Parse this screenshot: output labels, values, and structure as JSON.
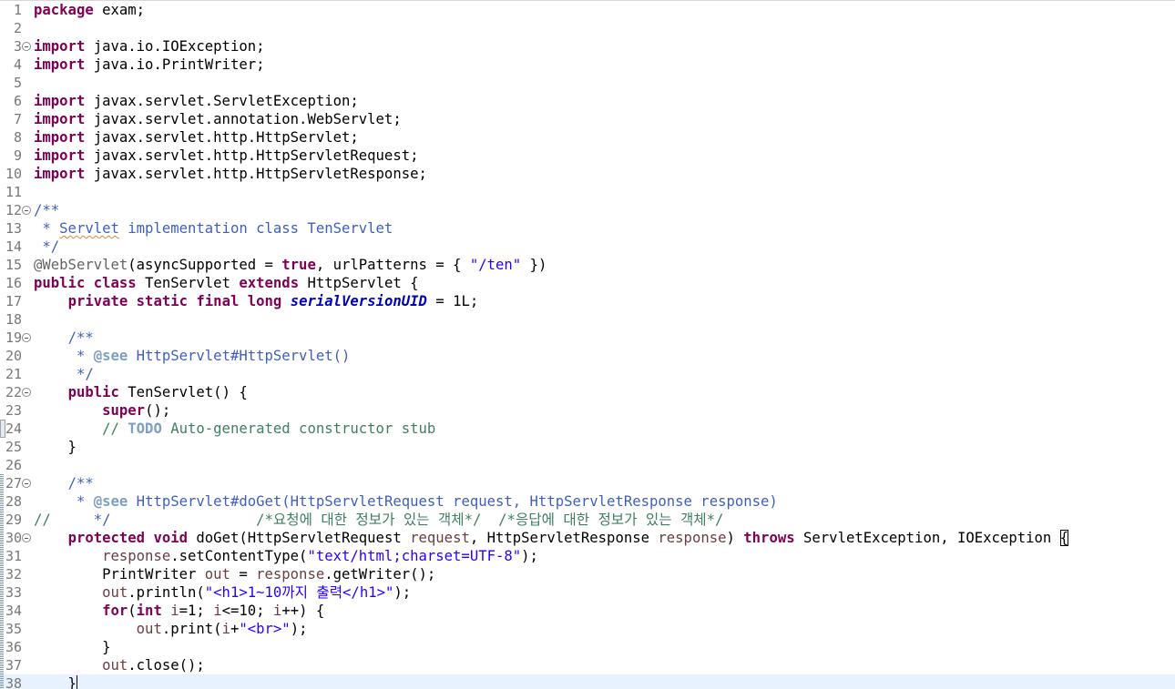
{
  "editor": {
    "language": "java",
    "file_package": "exam",
    "current_line": 38,
    "colors": {
      "keyword": "#7f0055",
      "string": "#2a00ff",
      "javadoc": "#3f5fbf",
      "javadoc_tag": "#7f9fbf",
      "comment": "#3f7f5f",
      "annotation": "#646464",
      "field": "#0000c0",
      "parameter": "#6a3e3e",
      "line_number": "#787878",
      "current_line_bg": "#e8f2fe"
    },
    "lines": [
      {
        "n": "1",
        "fold": false,
        "marker": "",
        "tokens": [
          [
            "kw",
            "package"
          ],
          [
            "plain",
            " exam;"
          ]
        ]
      },
      {
        "n": "2",
        "fold": false,
        "marker": "",
        "tokens": []
      },
      {
        "n": "3",
        "fold": true,
        "marker": "",
        "tokens": [
          [
            "kw",
            "import"
          ],
          [
            "plain",
            " java.io.IOException;"
          ]
        ]
      },
      {
        "n": "4",
        "fold": false,
        "marker": "",
        "tokens": [
          [
            "kw",
            "import"
          ],
          [
            "plain",
            " java.io.PrintWriter;"
          ]
        ]
      },
      {
        "n": "5",
        "fold": false,
        "marker": "",
        "tokens": []
      },
      {
        "n": "6",
        "fold": false,
        "marker": "",
        "tokens": [
          [
            "kw",
            "import"
          ],
          [
            "plain",
            " javax.servlet.ServletException;"
          ]
        ]
      },
      {
        "n": "7",
        "fold": false,
        "marker": "",
        "tokens": [
          [
            "kw",
            "import"
          ],
          [
            "plain",
            " javax.servlet.annotation.WebServlet;"
          ]
        ]
      },
      {
        "n": "8",
        "fold": false,
        "marker": "",
        "tokens": [
          [
            "kw",
            "import"
          ],
          [
            "plain",
            " javax.servlet.http.HttpServlet;"
          ]
        ]
      },
      {
        "n": "9",
        "fold": false,
        "marker": "",
        "tokens": [
          [
            "kw",
            "import"
          ],
          [
            "plain",
            " javax.servlet.http.HttpServletRequest;"
          ]
        ]
      },
      {
        "n": "10",
        "fold": false,
        "marker": "",
        "tokens": [
          [
            "kw",
            "import"
          ],
          [
            "plain",
            " javax.servlet.http.HttpServletResponse;"
          ]
        ]
      },
      {
        "n": "11",
        "fold": false,
        "marker": "",
        "tokens": []
      },
      {
        "n": "12",
        "fold": true,
        "marker": "",
        "tokens": [
          [
            "jdoc",
            "/**"
          ]
        ]
      },
      {
        "n": "13",
        "fold": false,
        "marker": "",
        "tokens": [
          [
            "jdoc",
            " * "
          ],
          [
            "spell",
            "Servlet"
          ],
          [
            "jdoc",
            " implementation class TenServlet"
          ]
        ]
      },
      {
        "n": "14",
        "fold": false,
        "marker": "",
        "tokens": [
          [
            "jdoc",
            " */"
          ]
        ]
      },
      {
        "n": "15",
        "fold": false,
        "marker": "",
        "tokens": [
          [
            "ann",
            "@WebServlet"
          ],
          [
            "plain",
            "(asyncSupported = "
          ],
          [
            "kw",
            "true"
          ],
          [
            "plain",
            ", urlPatterns = { "
          ],
          [
            "str",
            "\"/ten\""
          ],
          [
            "plain",
            " })"
          ]
        ]
      },
      {
        "n": "16",
        "fold": false,
        "marker": "",
        "tokens": [
          [
            "kw",
            "public"
          ],
          [
            "plain",
            " "
          ],
          [
            "kw",
            "class"
          ],
          [
            "plain",
            " TenServlet "
          ],
          [
            "kw",
            "extends"
          ],
          [
            "plain",
            " HttpServlet {"
          ]
        ]
      },
      {
        "n": "17",
        "fold": false,
        "marker": "",
        "tokens": [
          [
            "plain",
            "    "
          ],
          [
            "kw",
            "private"
          ],
          [
            "plain",
            " "
          ],
          [
            "kw",
            "static"
          ],
          [
            "plain",
            " "
          ],
          [
            "kw",
            "final"
          ],
          [
            "plain",
            " "
          ],
          [
            "kw",
            "long"
          ],
          [
            "plain",
            " "
          ],
          [
            "cfield",
            "serialVersionUID"
          ],
          [
            "plain",
            " = 1L;"
          ]
        ]
      },
      {
        "n": "18",
        "fold": false,
        "marker": "",
        "tokens": []
      },
      {
        "n": "19",
        "fold": true,
        "marker": "",
        "tokens": [
          [
            "plain",
            "    "
          ],
          [
            "jdoc",
            "/**"
          ]
        ]
      },
      {
        "n": "20",
        "fold": false,
        "marker": "",
        "tokens": [
          [
            "plain",
            "    "
          ],
          [
            "jdoc",
            " * "
          ],
          [
            "jtag",
            "@see"
          ],
          [
            "jdoc",
            " HttpServlet#HttpServlet()"
          ]
        ]
      },
      {
        "n": "21",
        "fold": false,
        "marker": "",
        "tokens": [
          [
            "plain",
            "    "
          ],
          [
            "jdoc",
            " */"
          ]
        ]
      },
      {
        "n": "22",
        "fold": true,
        "marker": "",
        "tokens": [
          [
            "plain",
            "    "
          ],
          [
            "kw",
            "public"
          ],
          [
            "plain",
            " TenServlet() {"
          ]
        ]
      },
      {
        "n": "23",
        "fold": false,
        "marker": "",
        "tokens": [
          [
            "plain",
            "        "
          ],
          [
            "kw",
            "super"
          ],
          [
            "plain",
            "();"
          ]
        ]
      },
      {
        "n": "24",
        "fold": false,
        "marker": "quick",
        "tokens": [
          [
            "plain",
            "        "
          ],
          [
            "comment",
            "// "
          ],
          [
            "todo",
            "TODO"
          ],
          [
            "comment",
            " Auto-generated constructor stub"
          ]
        ]
      },
      {
        "n": "25",
        "fold": false,
        "marker": "",
        "tokens": [
          [
            "plain",
            "    }"
          ]
        ]
      },
      {
        "n": "26",
        "fold": false,
        "marker": "",
        "tokens": []
      },
      {
        "n": "27",
        "fold": true,
        "marker": "change",
        "tokens": [
          [
            "plain",
            "    "
          ],
          [
            "jdoc",
            "/**"
          ]
        ]
      },
      {
        "n": "28",
        "fold": false,
        "marker": "change",
        "tokens": [
          [
            "plain",
            "    "
          ],
          [
            "jdoc",
            " * "
          ],
          [
            "jtag",
            "@see"
          ],
          [
            "jdoc",
            " HttpServlet#doGet(HttpServletRequest request, HttpServletResponse response)"
          ]
        ]
      },
      {
        "n": "29",
        "fold": false,
        "marker": "change",
        "tokens": [
          [
            "comment",
            "//"
          ],
          [
            "plain",
            "   "
          ],
          [
            "jdoc",
            "  */"
          ],
          [
            "plain",
            "                 "
          ],
          [
            "comment",
            "/*요청에 대한 정보가 있는 객체*/  /*응답에 대한 정보가 있는 객체*/"
          ]
        ]
      },
      {
        "n": "30",
        "fold": true,
        "marker": "change",
        "tokens": [
          [
            "plain",
            "    "
          ],
          [
            "kw",
            "protected"
          ],
          [
            "plain",
            " "
          ],
          [
            "kw",
            "void"
          ],
          [
            "plain",
            " doGet(HttpServletRequest "
          ],
          [
            "param",
            "request"
          ],
          [
            "plain",
            ", HttpServletResponse "
          ],
          [
            "param",
            "response"
          ],
          [
            "plain",
            ") "
          ],
          [
            "kw",
            "throws"
          ],
          [
            "plain",
            " ServletException, IOException "
          ],
          [
            "bracket",
            "{"
          ]
        ]
      },
      {
        "n": "31",
        "fold": false,
        "marker": "change",
        "tokens": [
          [
            "plain",
            "        "
          ],
          [
            "param",
            "response"
          ],
          [
            "plain",
            ".setContentType("
          ],
          [
            "str",
            "\"text/html;charset=UTF-8\""
          ],
          [
            "plain",
            ");"
          ]
        ]
      },
      {
        "n": "32",
        "fold": false,
        "marker": "change",
        "tokens": [
          [
            "plain",
            "        PrintWriter "
          ],
          [
            "local",
            "out"
          ],
          [
            "plain",
            " = "
          ],
          [
            "param",
            "response"
          ],
          [
            "plain",
            ".getWriter();"
          ]
        ]
      },
      {
        "n": "33",
        "fold": false,
        "marker": "change",
        "tokens": [
          [
            "plain",
            "        "
          ],
          [
            "local",
            "out"
          ],
          [
            "plain",
            ".println("
          ],
          [
            "str",
            "\"<h1>1~10까지 출력</h1>\""
          ],
          [
            "plain",
            ");"
          ]
        ]
      },
      {
        "n": "34",
        "fold": false,
        "marker": "change",
        "tokens": [
          [
            "plain",
            "        "
          ],
          [
            "kw",
            "for"
          ],
          [
            "plain",
            "("
          ],
          [
            "kw",
            "int"
          ],
          [
            "plain",
            " "
          ],
          [
            "local",
            "i"
          ],
          [
            "plain",
            "=1; "
          ],
          [
            "local",
            "i"
          ],
          [
            "plain",
            "<=10; "
          ],
          [
            "local",
            "i"
          ],
          [
            "plain",
            "++) {"
          ]
        ]
      },
      {
        "n": "35",
        "fold": false,
        "marker": "change",
        "tokens": [
          [
            "plain",
            "            "
          ],
          [
            "local",
            "out"
          ],
          [
            "plain",
            ".print("
          ],
          [
            "local",
            "i"
          ],
          [
            "plain",
            "+"
          ],
          [
            "str",
            "\"<br>\""
          ],
          [
            "plain",
            ");"
          ]
        ]
      },
      {
        "n": "36",
        "fold": false,
        "marker": "change",
        "tokens": [
          [
            "plain",
            "        }"
          ]
        ]
      },
      {
        "n": "37",
        "fold": false,
        "marker": "change",
        "tokens": [
          [
            "plain",
            "        "
          ],
          [
            "local",
            "out"
          ],
          [
            "plain",
            ".close();"
          ]
        ]
      },
      {
        "n": "38",
        "fold": false,
        "marker": "change",
        "tokens": [
          [
            "plain",
            "    }"
          ],
          [
            "caret",
            ""
          ]
        ]
      }
    ]
  }
}
